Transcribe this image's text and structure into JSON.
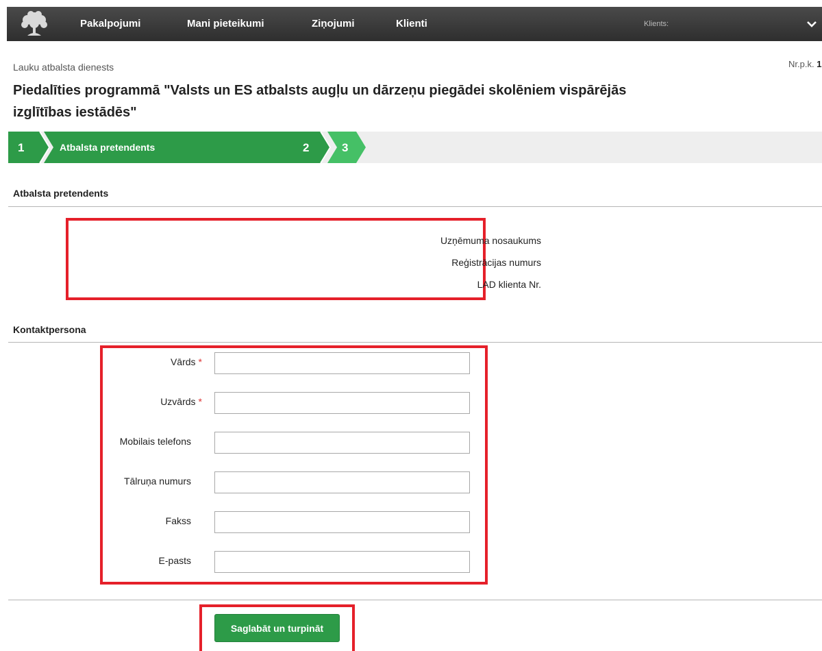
{
  "nav": {
    "items": [
      "Pakalpojumi",
      "Mani pieteikumi",
      "Ziņojumi",
      "Klienti"
    ],
    "client_label": "Klients:"
  },
  "header": {
    "org": "Lauku atbalsta dienests",
    "nrpk_label": "Nr.p.k.",
    "nrpk_value": "1",
    "title": "Piedalīties programmā \"Valsts un ES atbalsts augļu un dārzeņu piegādei skolēniem vispārējās izglītības iestādēs\""
  },
  "stepper": {
    "steps": [
      {
        "number": "1",
        "label": "Atbalsta pretendents"
      },
      {
        "number": "2",
        "label": ""
      },
      {
        "number": "3",
        "label": ""
      }
    ]
  },
  "applicant": {
    "section_title": "Atbalsta pretendents",
    "fields": [
      "Uzņēmuma nosaukums",
      "Reģistrācijas numurs",
      "LAD klienta Nr."
    ]
  },
  "contact": {
    "section_title": "Kontaktpersona",
    "fields": [
      {
        "label": "Vārds",
        "required": "*",
        "value": ""
      },
      {
        "label": "Uzvārds",
        "required": "*",
        "value": ""
      },
      {
        "label": "Mobilais telefons",
        "required": "",
        "value": ""
      },
      {
        "label": "Tālruņa numurs",
        "required": "",
        "value": ""
      },
      {
        "label": "Fakss",
        "required": "",
        "value": ""
      },
      {
        "label": "E-pasts",
        "required": "",
        "value": ""
      }
    ]
  },
  "actions": {
    "save_label": "Saglabāt un turpināt"
  },
  "colors": {
    "step_active": "#2d9b48",
    "step_next": "#45c066",
    "highlight": "#e5202a"
  }
}
